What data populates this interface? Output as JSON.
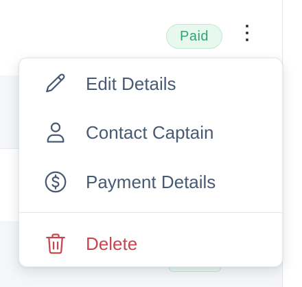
{
  "row": {
    "status_badge": "Paid"
  },
  "menu": {
    "items": [
      {
        "label": "Edit Details",
        "icon": "pencil-icon"
      },
      {
        "label": "Contact Captain",
        "icon": "user-icon"
      },
      {
        "label": "Payment Details",
        "icon": "dollar-circle-icon"
      }
    ],
    "delete": {
      "label": "Delete",
      "icon": "trash-icon"
    }
  },
  "colors": {
    "menu_text": "#465a73",
    "danger": "#c8454f",
    "badge_text": "#2fa36b",
    "badge_bg": "#e7f8ef"
  }
}
